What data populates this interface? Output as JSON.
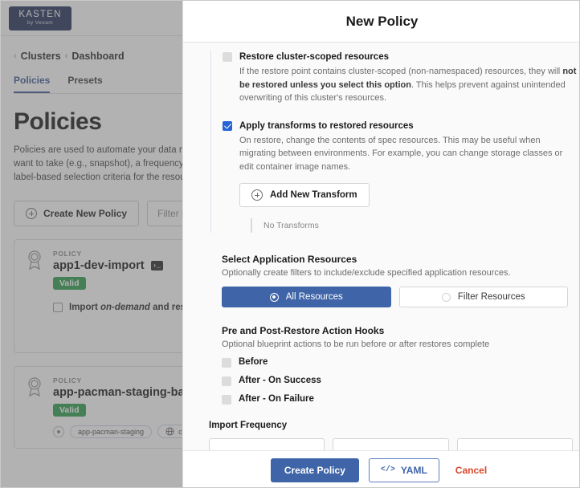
{
  "background": {
    "logo": {
      "main": "KASTEN",
      "sub": "by Veeam",
      "color": "#25335c"
    },
    "breadcrumb": [
      {
        "label": "Clusters"
      },
      {
        "label": "Dashboard"
      }
    ],
    "tabs": [
      {
        "label": "Policies",
        "active": true
      },
      {
        "label": "Presets",
        "active": false
      }
    ],
    "page_title": "Policies",
    "page_desc": "Policies are used to automate your data ma\nwant to take (e.g., snapshot), a frequency or\nlabel-based selection criteria for the resourc",
    "create_policy_button": "Create New Policy",
    "filter_placeholder": "Filter by",
    "policies": [
      {
        "kind_label": "POLICY",
        "name": "app1-dev-import",
        "status": "Valid",
        "status_color": "#2f9e4f",
        "summary": "Import on-demand and restore a",
        "summary_parts": {
          "pre": "Import ",
          "em": "on-demand",
          "post": " and restore a"
        },
        "terminal_icon": "terminal-icon",
        "chips": []
      },
      {
        "kind_label": "POLICY",
        "name": "app-pacman-staging-backup",
        "status": "Valid",
        "status_color": "#2f9e4f",
        "chips": [
          {
            "label": "app-pacman-staging",
            "icon": "dot-icon"
          },
          {
            "label": "cluster-sc",
            "icon": "globe-icon"
          }
        ]
      }
    ]
  },
  "modal": {
    "title": "New Policy",
    "restore_cluster_scoped": {
      "checked": false,
      "label": "Restore cluster-scoped resources",
      "desc_parts": {
        "p1": "If the restore point contains cluster-scoped (non-namespaced) resources, they will ",
        "b1": "not be restored unless you select this option",
        "p2": ". This helps prevent against unintended overwriting of this cluster's resources."
      }
    },
    "apply_transforms": {
      "checked": true,
      "label": "Apply transforms to restored resources",
      "desc": "On restore, change the contents of spec resources. This may be useful when migrating between environments. For example, you can change storage classes or edit container image names.",
      "add_button": "Add New Transform",
      "empty_text": "No Transforms"
    },
    "select_app_resources": {
      "title": "Select Application Resources",
      "desc": "Optionally create filters to include/exclude specified application resources.",
      "options": [
        {
          "label": "All Resources",
          "selected": true
        },
        {
          "label": "Filter Resources",
          "selected": false
        }
      ]
    },
    "action_hooks": {
      "title": "Pre and Post-Restore Action Hooks",
      "desc": "Optional blueprint actions to be run before or after restores complete",
      "items": [
        {
          "label": "Before",
          "checked": false
        },
        {
          "label": "After - On Success",
          "checked": false
        },
        {
          "label": "After - On Failure",
          "checked": false
        }
      ]
    },
    "import_frequency": {
      "title": "Import Frequency",
      "fields": [
        "",
        "",
        ""
      ]
    },
    "footer": {
      "primary": "Create Policy",
      "yaml": "YAML",
      "yaml_icon": "code-icon",
      "cancel": "Cancel",
      "primary_color": "#3f65a8",
      "cancel_color": "#d9472b"
    }
  }
}
